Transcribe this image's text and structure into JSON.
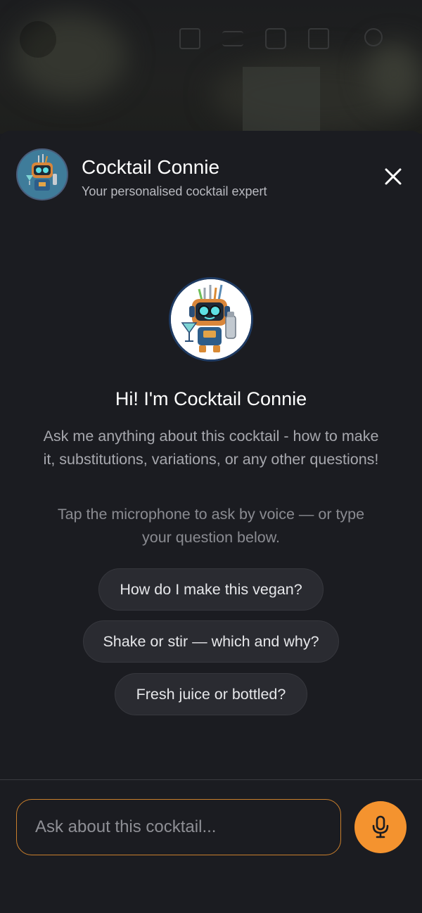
{
  "chat": {
    "title": "Cocktail Connie",
    "subtitle": "Your personalised cocktail expert",
    "greeting": "Hi! I'm Cocktail Connie",
    "intro": "Ask me anything about this cocktail - how to make it, substitutions, variations, or any other questions!",
    "voice_hint": "Tap the microphone to ask by voice — or type your question below.",
    "suggestions": [
      {
        "label": "How do I make this vegan?"
      },
      {
        "label": "Shake or stir — which and why?"
      },
      {
        "label": "Fresh juice or bottled?"
      }
    ],
    "input": {
      "placeholder": "Ask about this cocktail...",
      "value": ""
    }
  },
  "icons": {
    "close": "close-icon",
    "microphone": "microphone-icon",
    "avatar": "robot-bartender-avatar"
  },
  "colors": {
    "accent": "#f4932f",
    "input_border": "#c97f2c",
    "sheet_background": "#1b1c21",
    "chip_background": "#2a2b31"
  }
}
